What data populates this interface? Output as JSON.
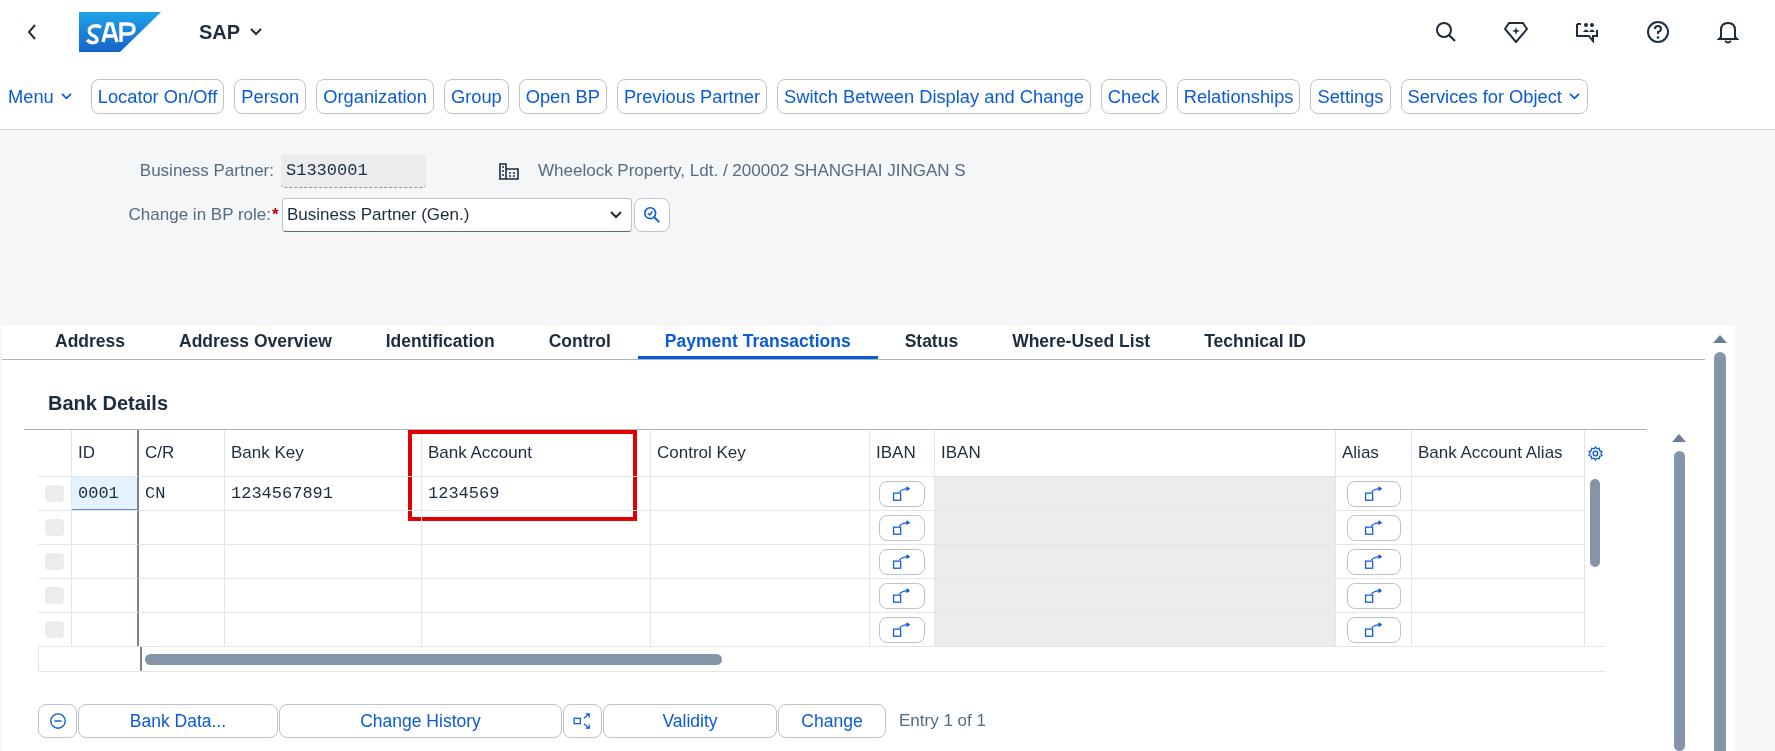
{
  "shell": {
    "title": "SAP"
  },
  "toolbar": [
    {
      "label": "Menu",
      "kind": "menu"
    },
    {
      "label": "Locator On/Off",
      "kind": "button"
    },
    {
      "label": "Person",
      "kind": "button"
    },
    {
      "label": "Organization",
      "kind": "button"
    },
    {
      "label": "Group",
      "kind": "button"
    },
    {
      "label": "Open BP",
      "kind": "button"
    },
    {
      "label": "Previous Partner",
      "kind": "button"
    },
    {
      "label": "Switch Between Display and Change",
      "kind": "button"
    },
    {
      "label": "Check",
      "kind": "button"
    },
    {
      "label": "Relationships",
      "kind": "button"
    },
    {
      "label": "Settings",
      "kind": "button"
    },
    {
      "label": "Services for Object",
      "kind": "menu_button"
    }
  ],
  "form": {
    "business_partner": {
      "label": "Business Partner:",
      "value": "S1330001",
      "description": "Wheelock Property, Ldt. / 200002 SHANGHAI JINGAN S"
    },
    "role": {
      "label": "Change in BP role:",
      "required_mark": "*",
      "value": "Business Partner (Gen.)"
    }
  },
  "tabs": [
    {
      "label": "Address",
      "selected": false
    },
    {
      "label": "Address Overview",
      "selected": false
    },
    {
      "label": "Identification",
      "selected": false
    },
    {
      "label": "Control",
      "selected": false
    },
    {
      "label": "Payment Transactions",
      "selected": true
    },
    {
      "label": "Status",
      "selected": false
    },
    {
      "label": "Where-Used List",
      "selected": false
    },
    {
      "label": "Technical ID",
      "selected": false
    }
  ],
  "section": {
    "title": "Bank Details"
  },
  "table": {
    "columns": [
      {
        "label": "ID",
        "highlighted": false
      },
      {
        "label": "C/R",
        "highlighted": false
      },
      {
        "label": "Bank Key",
        "highlighted": false
      },
      {
        "label": "Bank Account",
        "highlighted": true
      },
      {
        "label": "Control Key",
        "highlighted": false
      },
      {
        "label": "IBAN",
        "highlighted": false
      },
      {
        "label": "IBAN",
        "highlighted": false
      },
      {
        "label": "Alias",
        "highlighted": false
      },
      {
        "label": "Bank Account Alias",
        "highlighted": false
      }
    ],
    "rows": [
      {
        "id": "0001",
        "cr": "CN",
        "bank_key": "1234567891",
        "bank_account": "1234569",
        "focused": true
      },
      {
        "focused": false
      },
      {
        "focused": false
      },
      {
        "focused": false
      },
      {
        "focused": false
      }
    ]
  },
  "footer": {
    "buttons": [
      {
        "kind": "collapse"
      },
      {
        "label": "Bank Data...",
        "kind": "text"
      },
      {
        "label": "Change History",
        "kind": "text"
      },
      {
        "kind": "expand"
      },
      {
        "label": "Validity",
        "kind": "text"
      },
      {
        "label": "Change",
        "kind": "text"
      }
    ],
    "entry_count": "Entry 1 of 1"
  }
}
